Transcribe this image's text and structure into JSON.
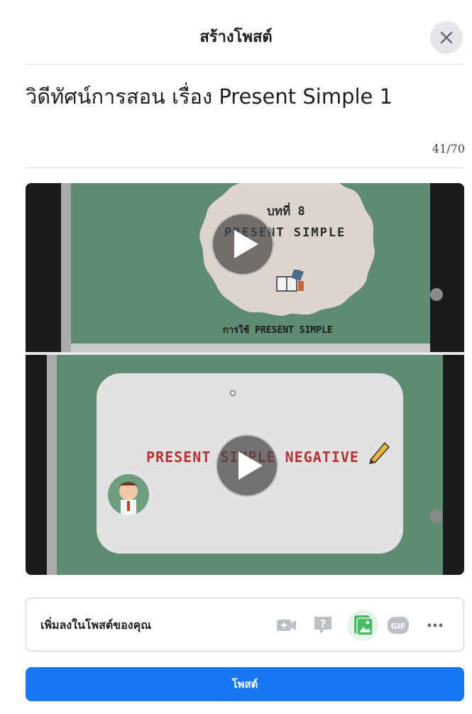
{
  "dialog": {
    "title": "สร้างโพสต์",
    "close_icon": "close-icon"
  },
  "post": {
    "text": "วิดีทัศน์การสอน เรื่อง Present Simple 1",
    "char_count": "41/70"
  },
  "media": {
    "video1": {
      "slide_lesson": "บทที่ 8",
      "slide_title": "PRESENT SIMPLE",
      "slide_caption": "การใช้ PRESENT SIMPLE"
    },
    "video2": {
      "slide_title": "PRESENT SIMPLE NEGATIVE"
    }
  },
  "add_to_post": {
    "label": "เพิ่มลงในโพสต์ของคุณ",
    "icons": [
      "video-icon",
      "question-icon",
      "photo-icon",
      "gif-icon",
      "more-icon"
    ],
    "gif_label": "GIF",
    "more_label": "···"
  },
  "post_button": {
    "label": "โพสต์"
  },
  "colors": {
    "primary": "#1877f2",
    "photo_accent": "#45bd62",
    "slide_green": "#5e8b72"
  }
}
